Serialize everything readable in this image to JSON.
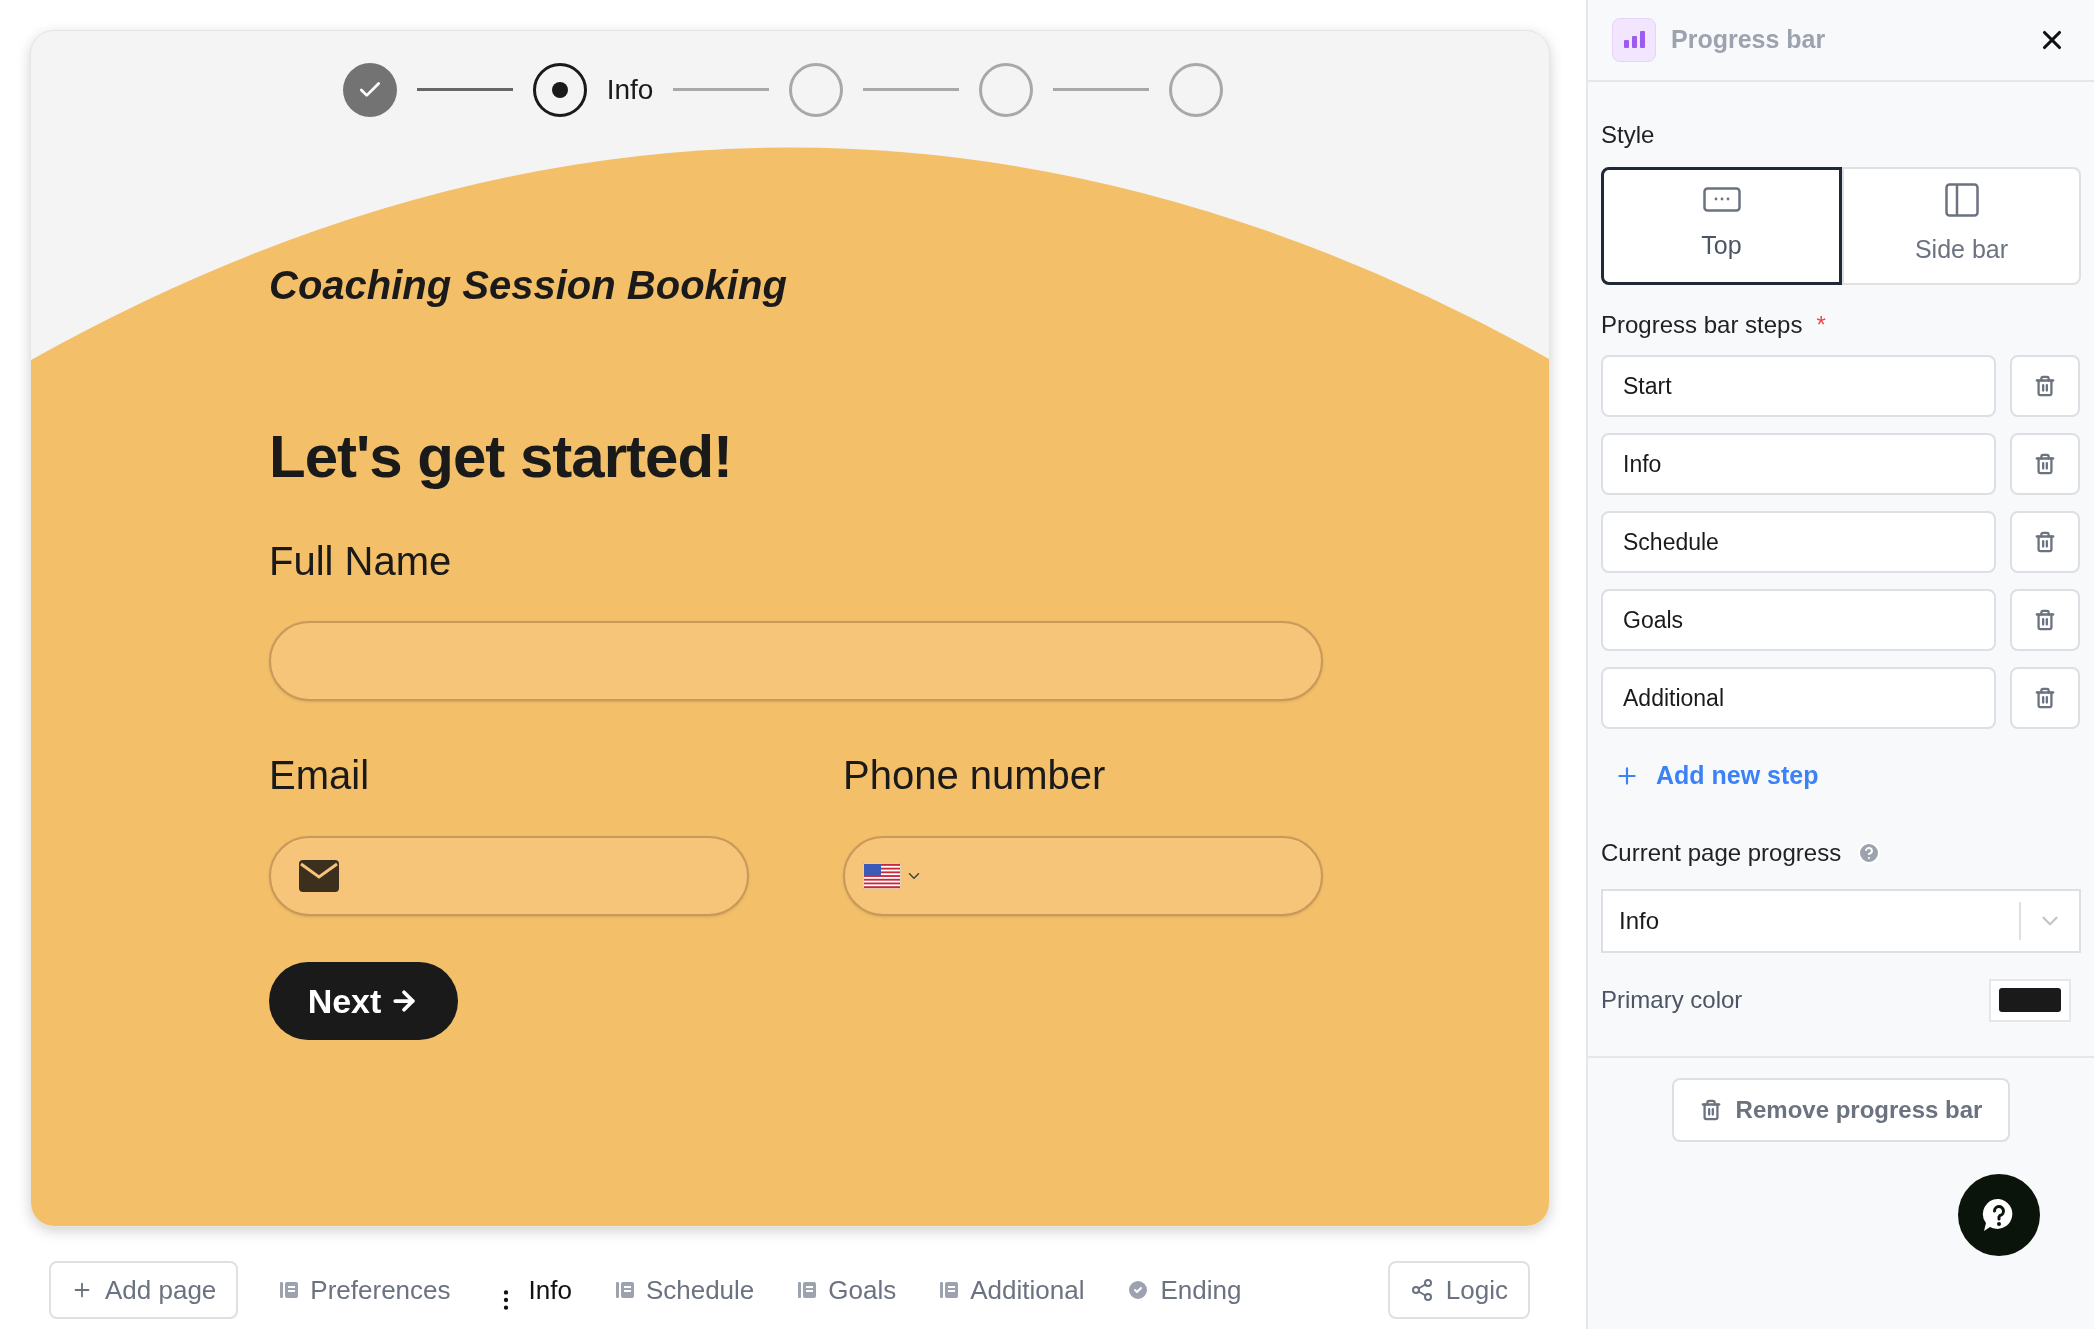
{
  "stepper": [
    {
      "done": true,
      "selected": false
    },
    {
      "done": false,
      "selected": true,
      "label": "Info"
    },
    {
      "done": false,
      "selected": false
    },
    {
      "done": false,
      "selected": false
    },
    {
      "done": false,
      "selected": false
    }
  ],
  "form": {
    "title": "Coaching Session Booking",
    "heading": "Let's get started!",
    "full_name_label": "Full Name",
    "email_label": "Email",
    "phone_label": "Phone number",
    "next_button": "Next"
  },
  "bottom_bar": {
    "add_page": "Add page",
    "pages": [
      {
        "label": "Preferences",
        "kind": "form",
        "selected": false
      },
      {
        "label": "Info",
        "kind": "form",
        "selected": true
      },
      {
        "label": "Schedule",
        "kind": "form",
        "selected": false
      },
      {
        "label": "Goals",
        "kind": "form",
        "selected": false
      },
      {
        "label": "Additional",
        "kind": "form",
        "selected": false
      },
      {
        "label": "Ending",
        "kind": "ending",
        "selected": false
      }
    ],
    "logic": "Logic"
  },
  "panel": {
    "title": "Progress bar",
    "style_label": "Style",
    "styles": [
      {
        "label": "Top",
        "kind": "top",
        "selected": true
      },
      {
        "label": "Side bar",
        "kind": "sidebar",
        "selected": false
      }
    ],
    "steps_label": "Progress bar steps",
    "required_mark": "*",
    "steps": [
      "Start",
      "Info",
      "Schedule",
      "Goals",
      "Additional"
    ],
    "add_step": "Add new step",
    "current_label": "Current page progress",
    "current_value": "Info",
    "primary_color": {
      "label": "Primary color",
      "color": "#1a1a1a"
    },
    "remove_button": "Remove progress bar"
  }
}
